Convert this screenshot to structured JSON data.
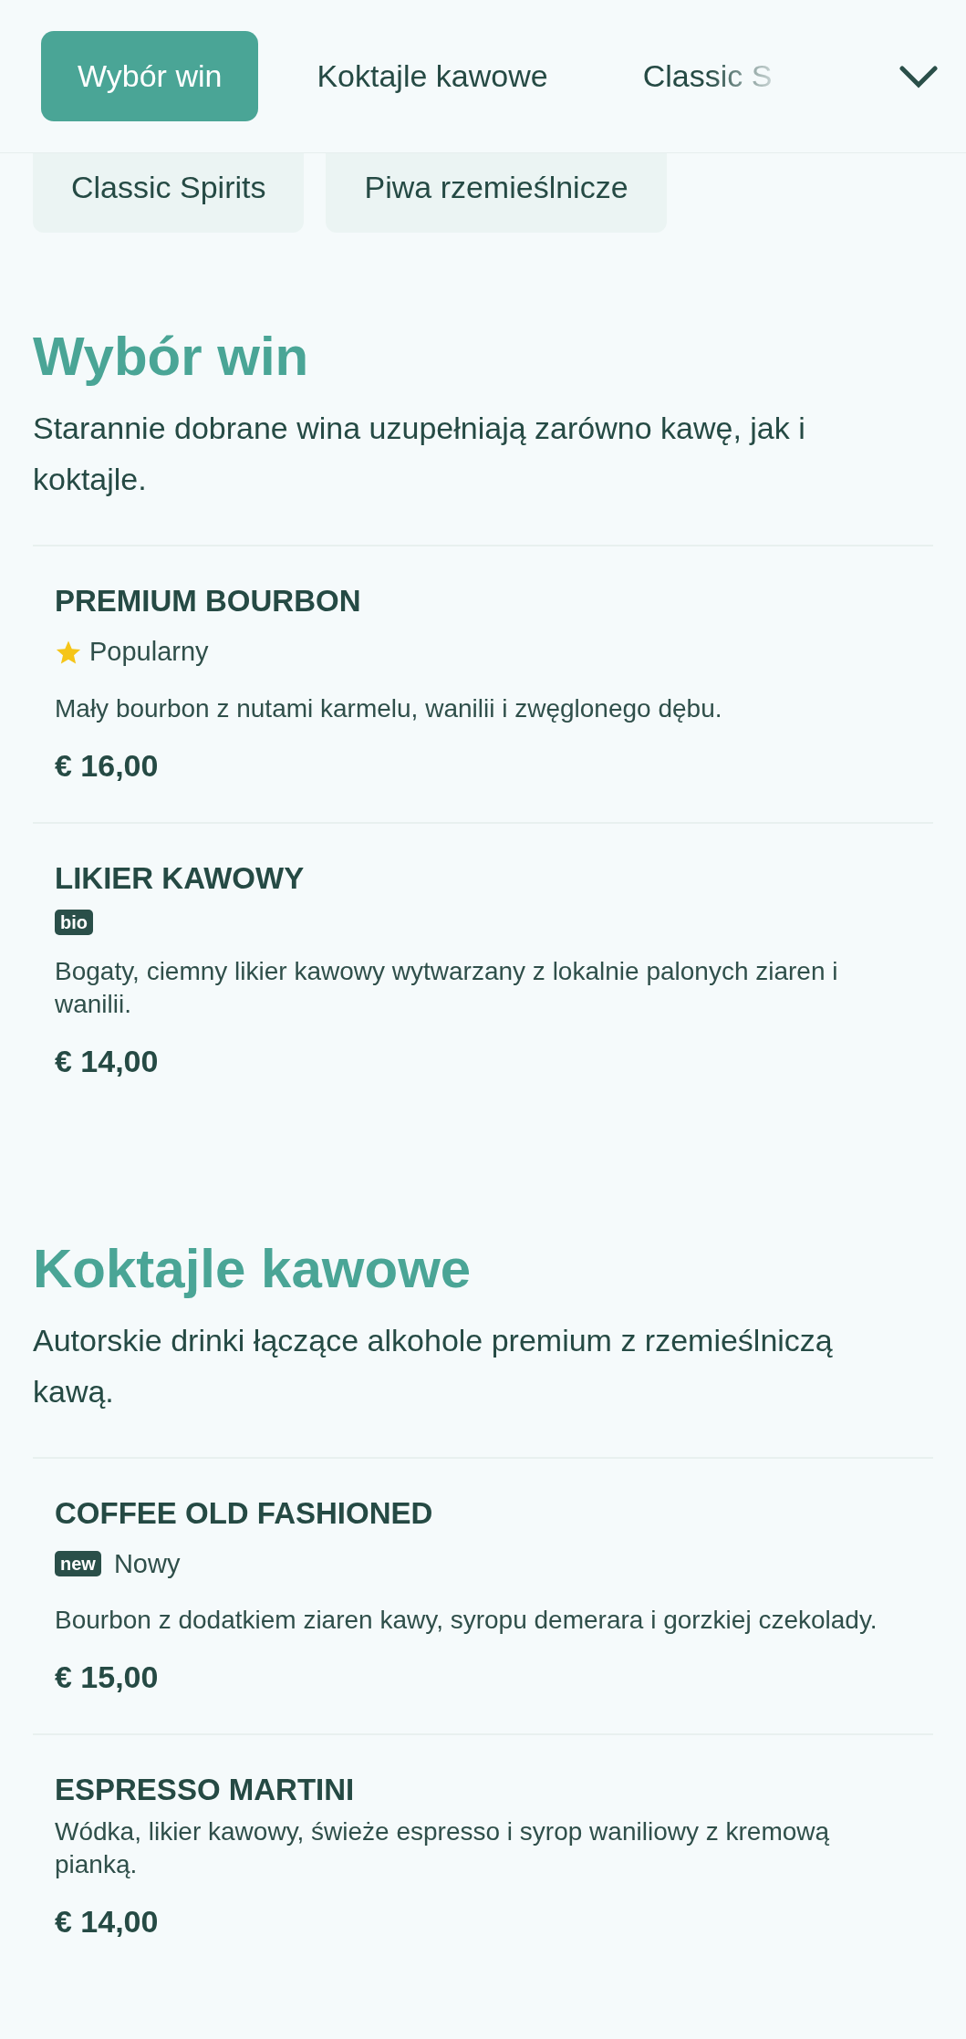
{
  "tabs": [
    {
      "label": "Wybór win",
      "selected": true
    },
    {
      "label": "Koktajle kawowe",
      "selected": false
    },
    {
      "label": "Classic S",
      "selected": false
    }
  ],
  "more_chips": [
    {
      "label": "Classic Spirits",
      "selected": false
    },
    {
      "label": "Piwa rzemieślnicze",
      "selected": false
    }
  ],
  "sections": [
    {
      "title": "Wybór win",
      "description": "Starannie dobrane wina uzupełniają zarówno kawę, jak i koktajle.",
      "items": [
        {
          "name": "PREMIUM BOURBON",
          "tags": [
            {
              "kind": "star",
              "text": "Popularny"
            }
          ],
          "description": "Mały bourbon z nutami karmelu, wanilii i zwęglonego dębu.",
          "price": "€ 16,00"
        },
        {
          "name": "LIKIER KAWOWY",
          "tags": [
            {
              "kind": "badge",
              "text": "bio"
            }
          ],
          "description": "Bogaty, ciemny likier kawowy wytwarzany z lokalnie palonych ziaren i wanilii.",
          "price": "€ 14,00"
        }
      ]
    },
    {
      "title": "Koktajle kawowe",
      "description": "Autorskie drinki łączące alkohole premium z rzemieślniczą kawą.",
      "items": [
        {
          "name": "COFFEE OLD FASHIONED",
          "tags": [
            {
              "kind": "badge",
              "text": "new"
            },
            {
              "kind": "label",
              "text": "Nowy"
            }
          ],
          "description": "Bourbon z dodatkiem ziaren kawy, syropu demerara i gorzkiej czekolady.",
          "price": "€ 15,00"
        },
        {
          "name": "ESPRESSO MARTINI",
          "description": "Wódka, likier kawowy, świeże espresso i syrop waniliowy z kremową pianką.",
          "price": "€ 14,00"
        }
      ]
    }
  ]
}
